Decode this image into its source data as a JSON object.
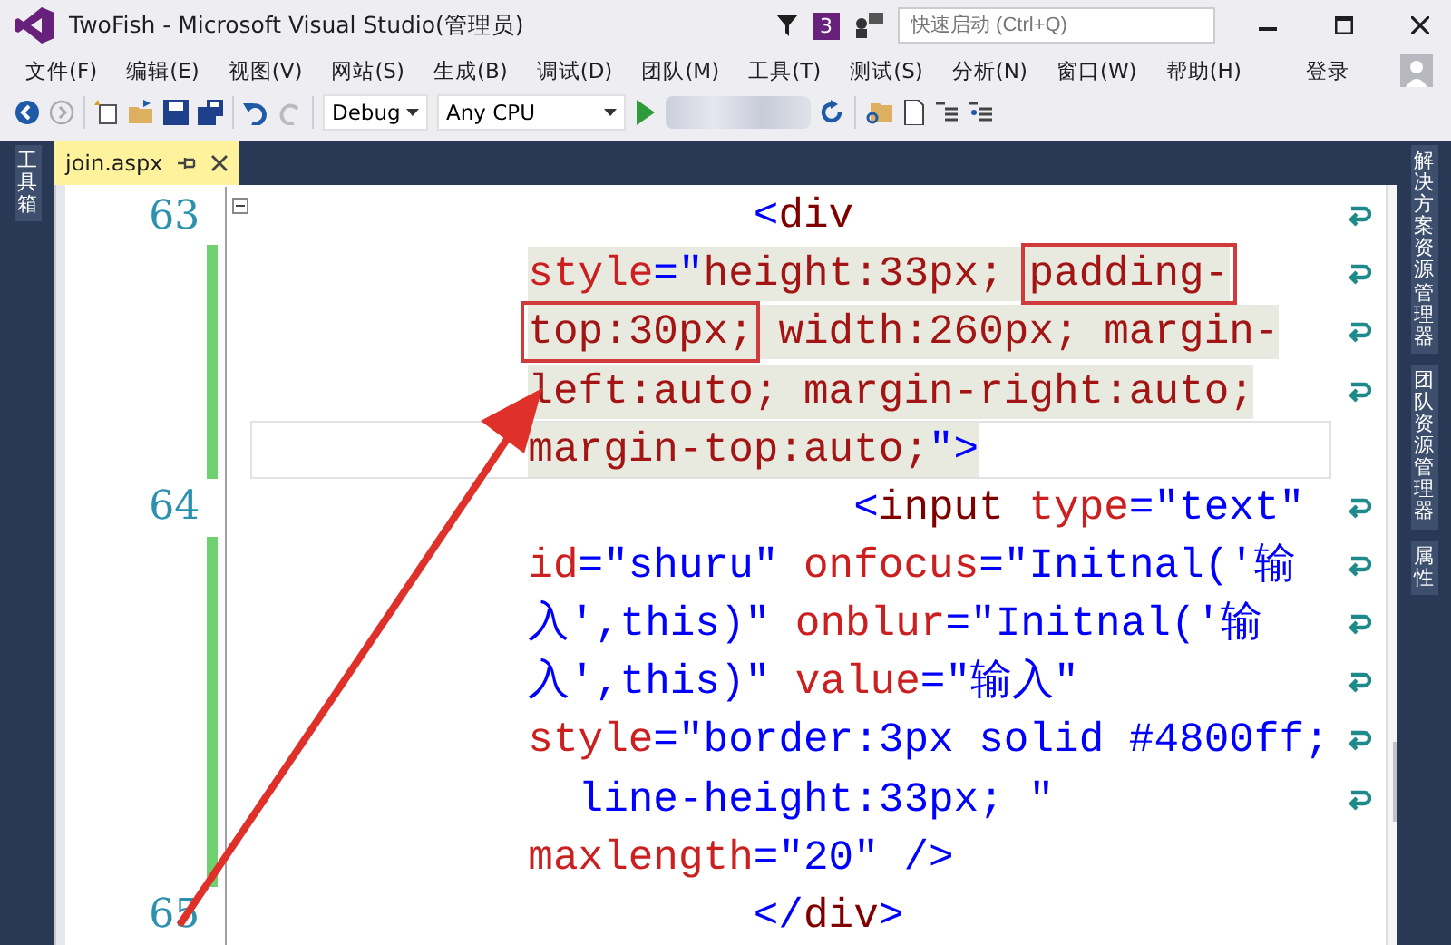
{
  "window": {
    "title": "TwoFish - Microsoft Visual Studio(管理员)",
    "notification_count": "3",
    "search": {
      "placeholder": "快速启动 (Ctrl+Q)"
    }
  },
  "menu": [
    "文件(F)",
    "编辑(E)",
    "视图(V)",
    "网站(S)",
    "生成(B)",
    "调试(D)",
    "团队(M)",
    "工具(T)",
    "测试(S)",
    "分析(N)",
    "窗口(W)",
    "帮助(H)"
  ],
  "sign_in": "登录",
  "toolbar": {
    "configuration": "Debug",
    "platform": "Any CPU"
  },
  "left_panel": [
    "工具箱"
  ],
  "right_panel": [
    "解决方案资源管理器",
    "团队资源管理器",
    "属性"
  ],
  "tabs": [
    {
      "label": "join.aspx",
      "selected": true
    }
  ],
  "code": [
    {
      "number": "63",
      "collapsible": true,
      "rows": [
        {
          "changed": false,
          "shaded": false,
          "current": false,
          "tokens": [
            {
              "kind": "punct",
              "text": "         <"
            },
            {
              "kind": "tag",
              "text": "div"
            }
          ]
        },
        {
          "changed": true,
          "shaded": true,
          "current": false,
          "tokens": [
            {
              "kind": "attr",
              "text": "style"
            },
            {
              "kind": "punct",
              "text": "=\""
            },
            {
              "kind": "css",
              "text": "height:33px; "
            },
            {
              "kind": "css",
              "text": "padding-",
              "marked": true
            }
          ]
        },
        {
          "changed": true,
          "shaded": true,
          "current": false,
          "tokens": [
            {
              "kind": "css",
              "text": "top:30px;",
              "marked": true
            },
            {
              "kind": "css",
              "text": " width:260px; margin-"
            }
          ]
        },
        {
          "changed": true,
          "shaded": true,
          "current": false,
          "tokens": [
            {
              "kind": "css",
              "text": "left:auto; margin-right:auto;"
            }
          ]
        },
        {
          "changed": true,
          "shaded": true,
          "current": true,
          "tokens": [
            {
              "kind": "css",
              "text": "margin-top:auto;"
            },
            {
              "kind": "punct",
              "text": "\">"
            }
          ]
        }
      ]
    },
    {
      "number": "64",
      "collapsible": false,
      "rows": [
        {
          "changed": false,
          "shaded": false,
          "current": false,
          "tokens": [
            {
              "kind": "punct",
              "text": "             <"
            },
            {
              "kind": "tag",
              "text": "input"
            },
            {
              "kind": "attr",
              "text": " type"
            },
            {
              "kind": "punct",
              "text": "=\""
            },
            {
              "kind": "value",
              "text": "text"
            },
            {
              "kind": "punct",
              "text": "\""
            }
          ]
        },
        {
          "changed": true,
          "shaded": false,
          "current": false,
          "tokens": [
            {
              "kind": "attr",
              "text": "id"
            },
            {
              "kind": "punct",
              "text": "=\""
            },
            {
              "kind": "value",
              "text": "shuru"
            },
            {
              "kind": "punct",
              "text": "\" "
            },
            {
              "kind": "attr",
              "text": "onfocus"
            },
            {
              "kind": "punct",
              "text": "=\""
            },
            {
              "kind": "value",
              "text": "Initnal('输"
            }
          ]
        },
        {
          "changed": true,
          "shaded": false,
          "current": false,
          "tokens": [
            {
              "kind": "value",
              "text": "入',this)"
            },
            {
              "kind": "punct",
              "text": "\" "
            },
            {
              "kind": "attr",
              "text": "onblur"
            },
            {
              "kind": "punct",
              "text": "=\""
            },
            {
              "kind": "value",
              "text": "Initnal('输"
            }
          ]
        },
        {
          "changed": true,
          "shaded": false,
          "current": false,
          "tokens": [
            {
              "kind": "value",
              "text": "入',this)"
            },
            {
              "kind": "punct",
              "text": "\" "
            },
            {
              "kind": "attr",
              "text": "value"
            },
            {
              "kind": "punct",
              "text": "=\""
            },
            {
              "kind": "value",
              "text": "输入"
            },
            {
              "kind": "punct",
              "text": "\""
            }
          ]
        },
        {
          "changed": true,
          "shaded": false,
          "current": false,
          "tokens": [
            {
              "kind": "attr",
              "text": "style"
            },
            {
              "kind": "punct",
              "text": "=\""
            },
            {
              "kind": "value",
              "text": "border:3px solid #4800ff;"
            }
          ]
        },
        {
          "changed": true,
          "shaded": false,
          "current": false,
          "tokens": [
            {
              "kind": "value",
              "text": "  line-height:33px; "
            },
            {
              "kind": "punct",
              "text": "\""
            }
          ]
        },
        {
          "changed": true,
          "shaded": false,
          "current": false,
          "tokens": [
            {
              "kind": "attr",
              "text": "maxlength"
            },
            {
              "kind": "punct",
              "text": "=\""
            },
            {
              "kind": "value",
              "text": "20"
            },
            {
              "kind": "punct",
              "text": "\" />"
            }
          ]
        }
      ]
    },
    {
      "number": "65",
      "collapsible": false,
      "rows": [
        {
          "changed": false,
          "shaded": false,
          "current": false,
          "tokens": [
            {
              "kind": "punct",
              "text": "         </"
            },
            {
              "kind": "tag",
              "text": "div"
            },
            {
              "kind": "punct",
              "text": ">"
            }
          ]
        }
      ]
    }
  ]
}
